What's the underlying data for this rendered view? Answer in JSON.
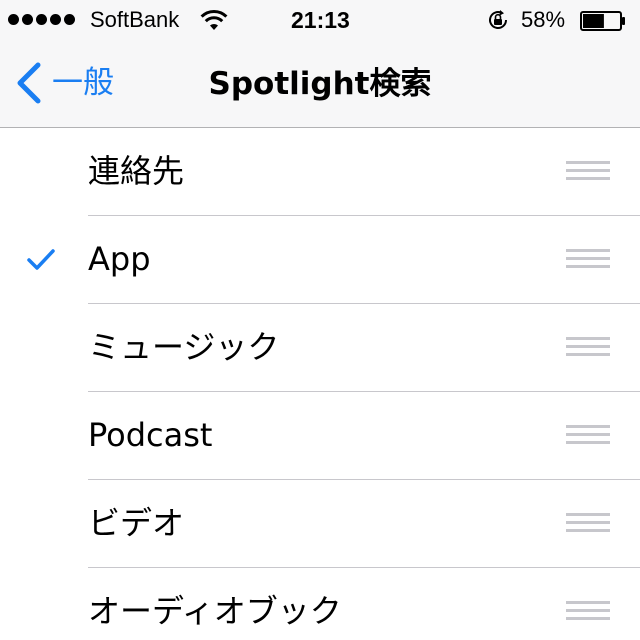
{
  "status_bar": {
    "carrier": "SoftBank",
    "time": "21:13",
    "battery_percent": "58%",
    "battery_level": 0.58,
    "signal_bars": 5,
    "icons": [
      "signal-dots-icon",
      "wifi-icon",
      "rotation-lock-icon",
      "battery-icon"
    ]
  },
  "nav": {
    "back_label": "一般",
    "title": "Spotlight検索"
  },
  "list": {
    "items": [
      {
        "label": "連絡先",
        "checked": false
      },
      {
        "label": "App",
        "checked": true
      },
      {
        "label": "ミュージック",
        "checked": false
      },
      {
        "label": "Podcast",
        "checked": false
      },
      {
        "label": "ビデオ",
        "checked": false
      },
      {
        "label": "オーディオブック",
        "checked": false
      }
    ]
  },
  "colors": {
    "accent": "#1a7ef2",
    "bar_background": "#f7f7f8",
    "separator": "#c8c7cc",
    "handle": "#c7c7cc"
  }
}
